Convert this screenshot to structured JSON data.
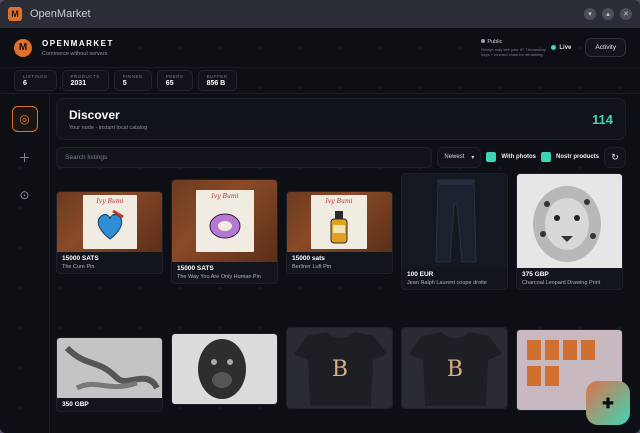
{
  "window": {
    "title": "OpenMarket"
  },
  "brand": {
    "name": "OPENMARKET",
    "subtitle": "Commerce without servers"
  },
  "public": {
    "title": "Public",
    "description": "Relays may see your IP. Throwaway keys + forward chain for deniability."
  },
  "live_label": "Live",
  "activity_label": "Activity",
  "stats": [
    {
      "label": "LISTINGS",
      "value": "6"
    },
    {
      "label": "PRODUCTS",
      "value": "2031"
    },
    {
      "label": "PINNED",
      "value": "5"
    },
    {
      "label": "PEERS",
      "value": "65"
    },
    {
      "label": "BUFFER",
      "value": "856 B"
    }
  ],
  "discover": {
    "title": "Discover",
    "subtitle": "Your node · instant local catalog",
    "count": "114"
  },
  "toolbar": {
    "search_placeholder": "Search listings",
    "sort_value": "Newest",
    "with_photos": "With photos",
    "nostr_products": "Nostr products"
  },
  "listings": [
    {
      "price": "15000 SATS",
      "title": "The Cure Pin",
      "pin_brand": "Ivy Bumi"
    },
    {
      "price": "15000 SATS",
      "title": "The Way You Are Only Human Pin",
      "pin_brand": "Ivy Bumi"
    },
    {
      "price": "15000 sats",
      "title": "Berliner Luft Pin",
      "pin_brand": "Ivy Bumi"
    },
    {
      "price": "100 EUR",
      "title": "Jean Ralph Laurent coupe droite"
    },
    {
      "price": "375 GBP",
      "title": "Charcoal Leopard Drawing Print"
    },
    {
      "price": "350 GBP",
      "title": ""
    },
    {
      "price": "",
      "title": ""
    },
    {
      "price": "",
      "title": ""
    },
    {
      "price": "",
      "title": ""
    },
    {
      "price": "",
      "title": ""
    }
  ],
  "colors": {
    "accent": "#3dd6b5",
    "brand": "#e0702a",
    "background": "#0d0f15"
  }
}
